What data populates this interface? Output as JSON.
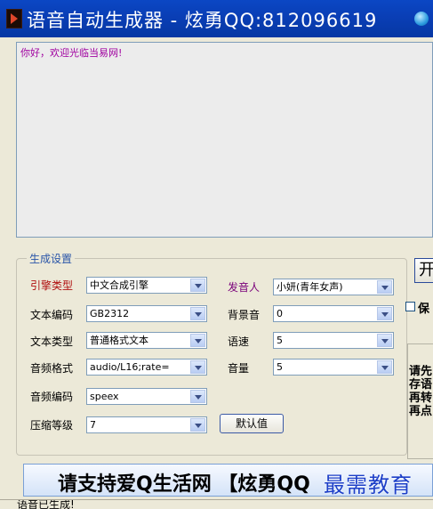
{
  "window": {
    "title": "语音自动生成器 - 炫勇QQ:812096619",
    "icon": "app-icon"
  },
  "output": {
    "text": "你好，欢迎光临当易网!"
  },
  "settings": {
    "group_title": "生成设置",
    "engine": {
      "label": "引擎类型",
      "value": "中文合成引擎"
    },
    "text_encoding": {
      "label": "文本编码",
      "value": "GB2312"
    },
    "text_type": {
      "label": "文本类型",
      "value": "普通格式文本"
    },
    "audio_format": {
      "label": "音频格式",
      "value": "audio/L16;rate="
    },
    "audio_encoding": {
      "label": "音频编码",
      "value": "speex"
    },
    "compression": {
      "label": "压缩等级",
      "value": "7"
    },
    "default_button": "默认值",
    "speaker": {
      "label": "发音人",
      "value": "小妍(青年女声)"
    },
    "background": {
      "label": "背景音",
      "value": "0"
    },
    "speed": {
      "label": "语速",
      "value": "5"
    },
    "volume": {
      "label": "音量",
      "value": "5"
    }
  },
  "right_side": {
    "button": "开",
    "checkbox_label": "保",
    "lines": [
      "请先",
      "存语",
      "再转",
      "再点"
    ]
  },
  "banner": {
    "text": "请支持爱Q生活网 【炫勇QQ",
    "watermark": "最需教育"
  },
  "status": {
    "text": "语音已生成!"
  },
  "colors": {
    "title_bar": "#0a3fb7",
    "output_text": "#a000a0",
    "engine_label": "#b01010",
    "speaker_label": "#7a007a",
    "group_title": "#2a55a8",
    "watermark": "#1d3fc8"
  }
}
